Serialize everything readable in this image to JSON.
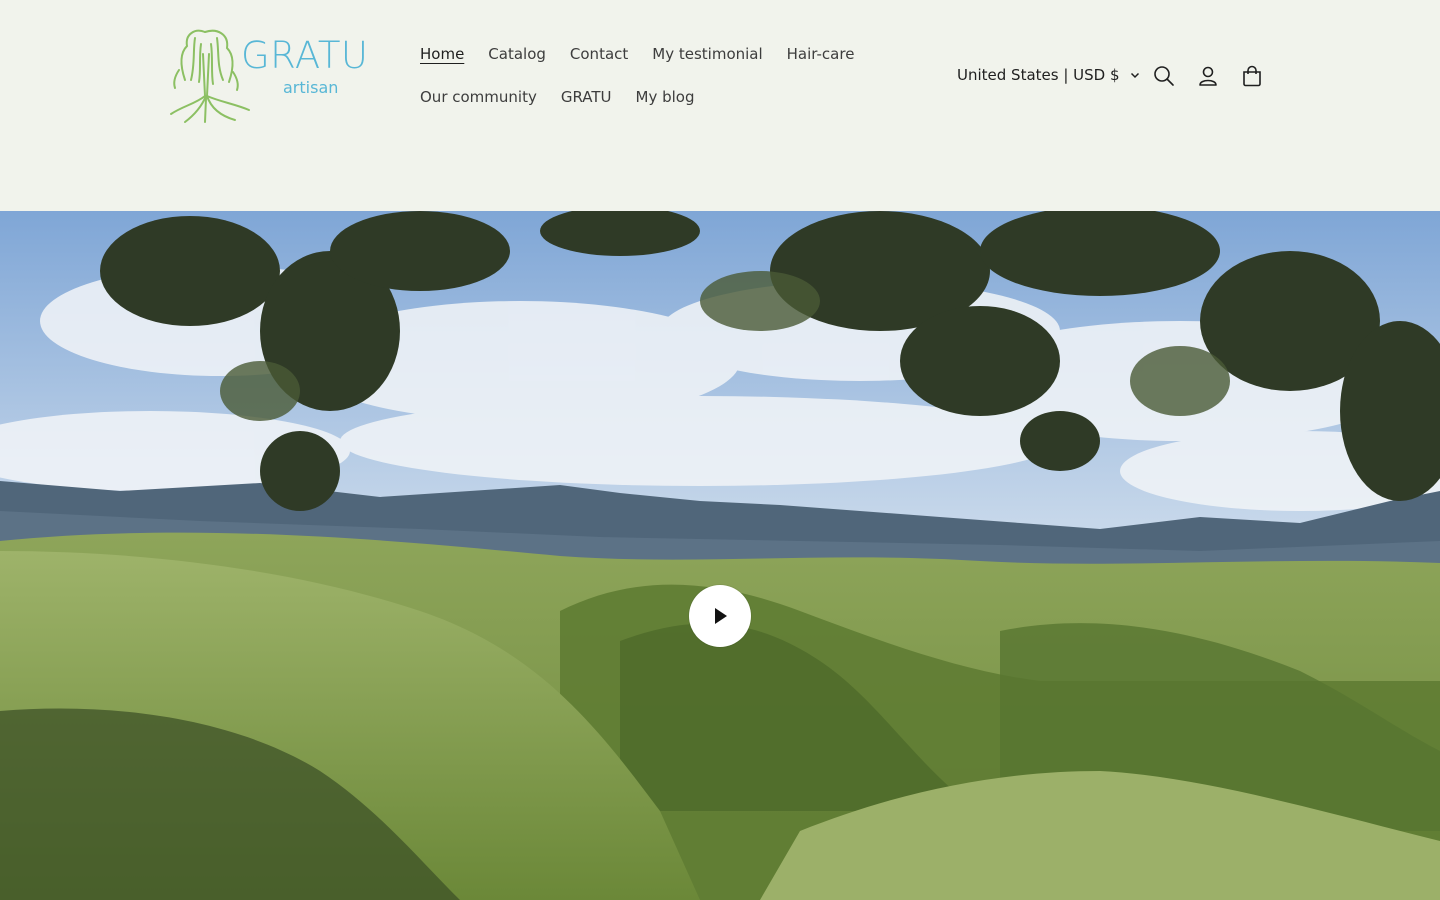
{
  "brand": {
    "name": "GRATU",
    "tagline": "artisan",
    "color": "#58b7d6",
    "tree_color": "#8cc063"
  },
  "nav": {
    "row1": [
      {
        "label": "Home",
        "active": true
      },
      {
        "label": "Catalog"
      },
      {
        "label": "Contact"
      },
      {
        "label": "My testimonial"
      },
      {
        "label": "Hair-care"
      }
    ],
    "row2": [
      {
        "label": "Our community"
      },
      {
        "label": "GRATU"
      },
      {
        "label": "My blog"
      }
    ]
  },
  "header": {
    "currency_label": "United States | USD $",
    "icons": [
      "search-icon",
      "account-icon",
      "cart-icon"
    ]
  },
  "hero": {
    "type": "video",
    "play_icon": "play-icon",
    "scene": "mountain-landscape"
  }
}
